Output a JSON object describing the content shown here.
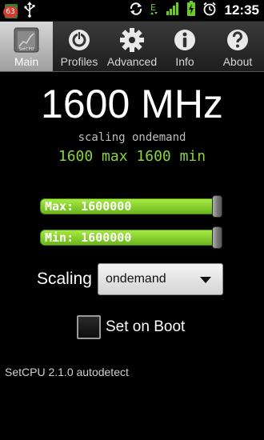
{
  "status_bar": {
    "notification_count": "63",
    "clock": "12:35",
    "icons": [
      "app-notification-icon",
      "usb-icon",
      "sync-icon",
      "data-e-icon",
      "signal-icon",
      "battery-icon",
      "alarm-icon"
    ]
  },
  "tabs": [
    {
      "label": "Main",
      "icon": "cpu-chip-icon",
      "active": true
    },
    {
      "label": "Profiles",
      "icon": "power-icon",
      "active": false
    },
    {
      "label": "Advanced",
      "icon": "gear-icon",
      "active": false
    },
    {
      "label": "Info",
      "icon": "info-icon",
      "active": false
    },
    {
      "label": "About",
      "icon": "question-icon",
      "active": false
    }
  ],
  "main": {
    "frequency": "1600 MHz",
    "scaling_status": "scaling ondemand",
    "max_min_status": "1600 max 1600 min",
    "max_slider": {
      "label": "Max: 1600000",
      "level": 1.0
    },
    "min_slider": {
      "label": "Min: 1600000",
      "level": 1.0
    },
    "scaling_label": "Scaling",
    "scaling_value": "ondemand",
    "set_on_boot_label": "Set on Boot",
    "set_on_boot_checked": false
  },
  "footer": {
    "text": "SetCPU 2.1.0 autodetect"
  },
  "colors": {
    "accent_green": "#8bd43a",
    "slider_green": "#8fd532",
    "background": "#000000"
  }
}
